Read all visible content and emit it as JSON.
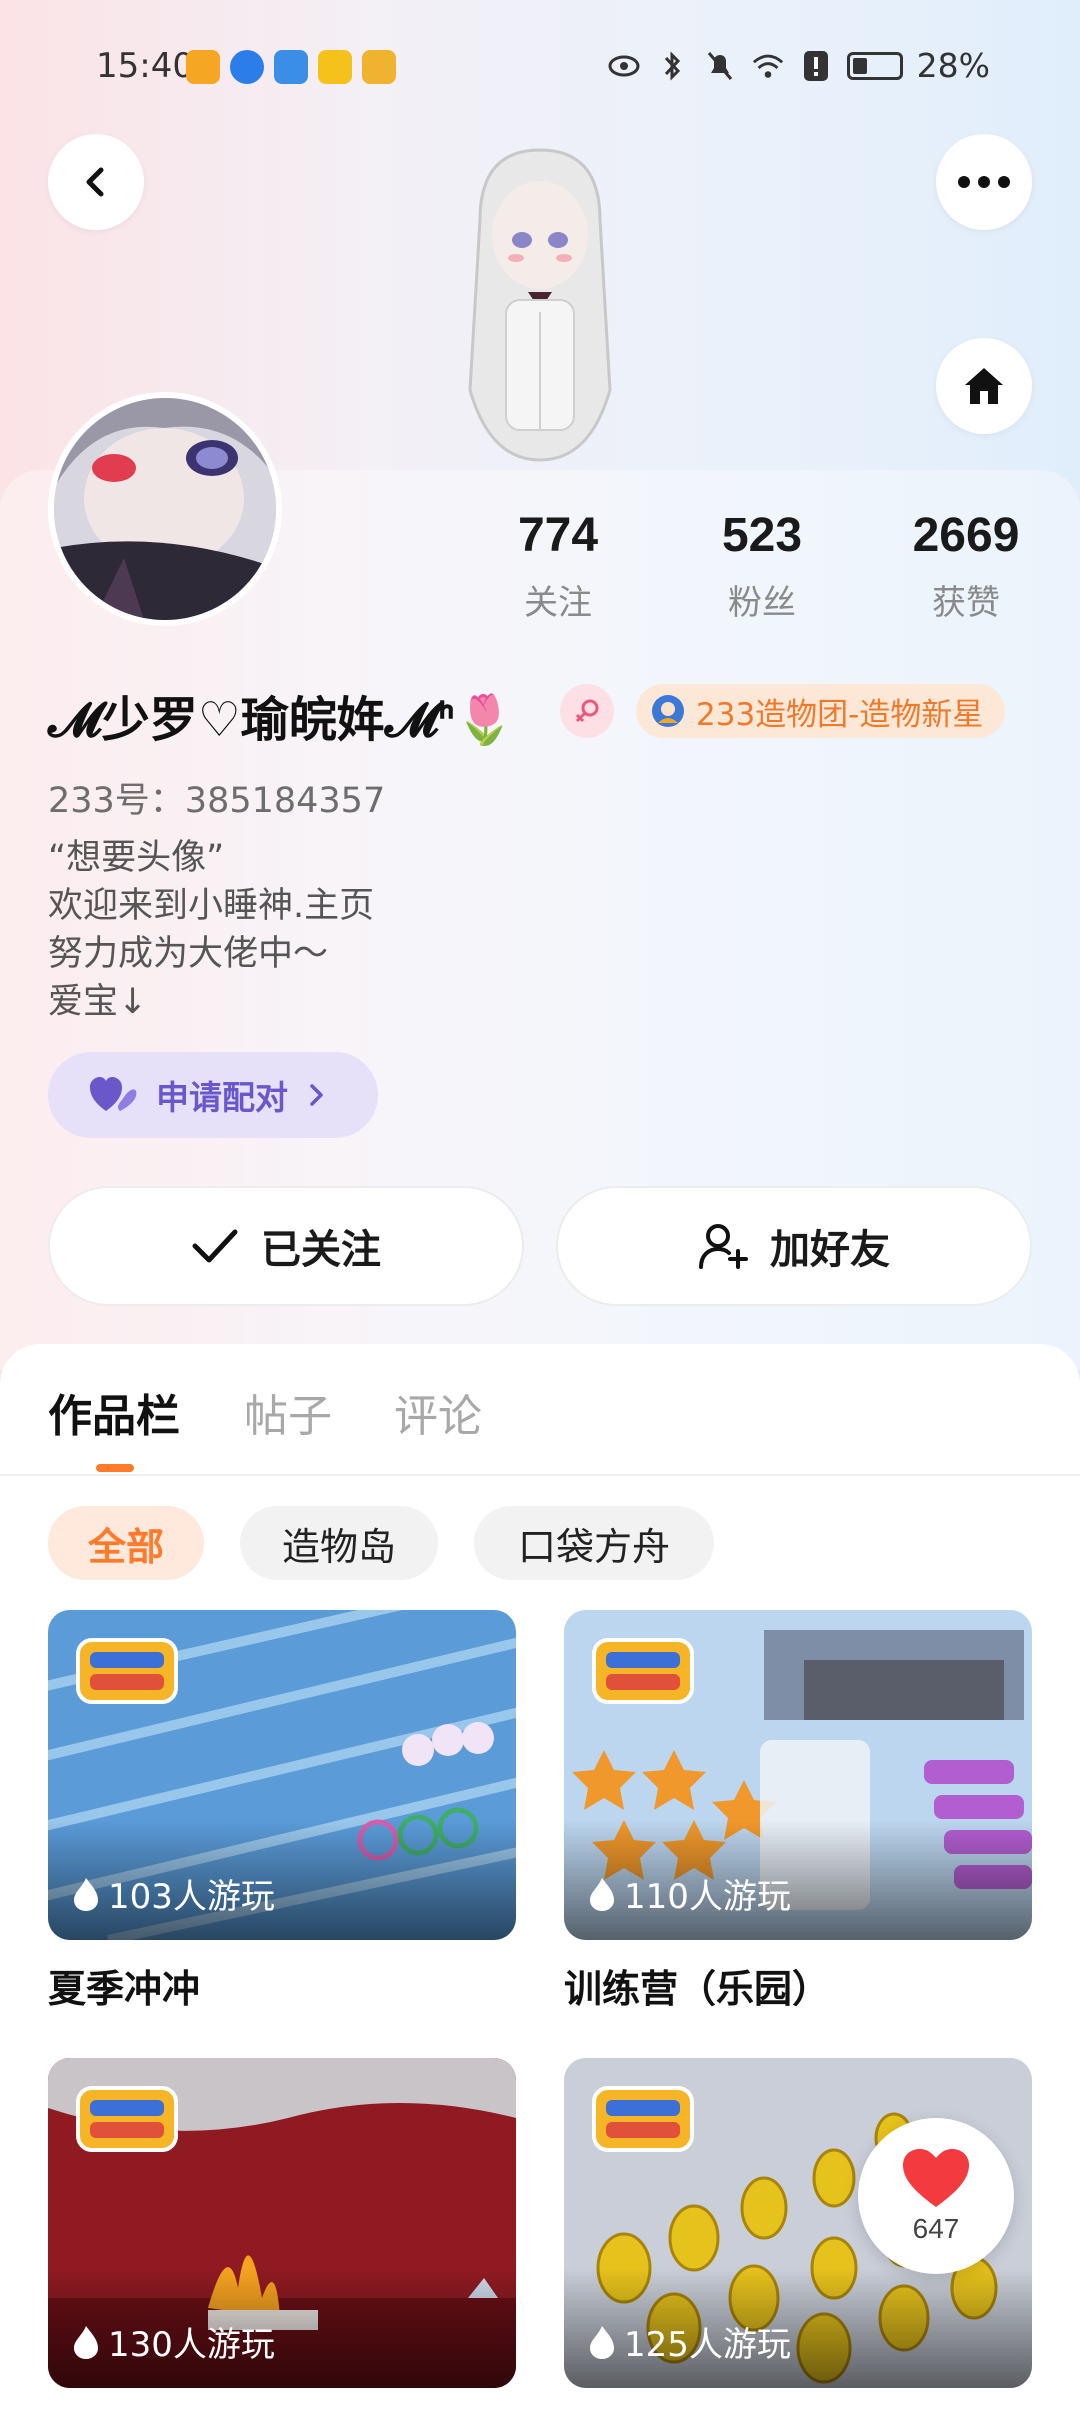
{
  "status_bar": {
    "time": "15:40",
    "battery": "28%",
    "app_icons": [
      "shield-app-icon",
      "browser-app-icon",
      "note-app-icon",
      "game-app-icon",
      "weibo-app-icon"
    ]
  },
  "header": {
    "back_icon": "chevron-left-icon",
    "more_icon": "more-icon",
    "home_icon": "home-icon"
  },
  "profile": {
    "stats": [
      {
        "value": "774",
        "label": "关注"
      },
      {
        "value": "523",
        "label": "粉丝"
      },
      {
        "value": "2669",
        "label": "获赞"
      }
    ],
    "nickname": "𝓜少罗♡瑜皖姩𝓜ᑋ🌷",
    "gender": "female",
    "title_badge": "233造物团-造物新星",
    "uid": "233号：385184357",
    "bio_lines": [
      "“想要头像”",
      "欢迎来到小睡神.主页",
      "努力成为大佬中～",
      "爱宝↓"
    ],
    "pair_button": "申请配对"
  },
  "actions": {
    "following": "已关注",
    "add_friend": "加好友"
  },
  "tabs": [
    {
      "label": "作品栏",
      "active": true
    },
    {
      "label": "帖子",
      "active": false
    },
    {
      "label": "评论",
      "active": false
    }
  ],
  "filters": [
    {
      "label": "全部",
      "active": true
    },
    {
      "label": "造物岛",
      "active": false
    },
    {
      "label": "口袋方舟",
      "active": false
    }
  ],
  "works": [
    {
      "players": "103人游玩",
      "title": "夏季冲冲"
    },
    {
      "players": "110人游玩",
      "title": "训练营（乐园）"
    },
    {
      "players": "130人游玩",
      "title": ""
    },
    {
      "players": "125人游玩",
      "title": ""
    }
  ],
  "like_float": {
    "count": "647"
  },
  "colors": {
    "accent": "#ff7a2a",
    "pair": "#6a57c9"
  }
}
